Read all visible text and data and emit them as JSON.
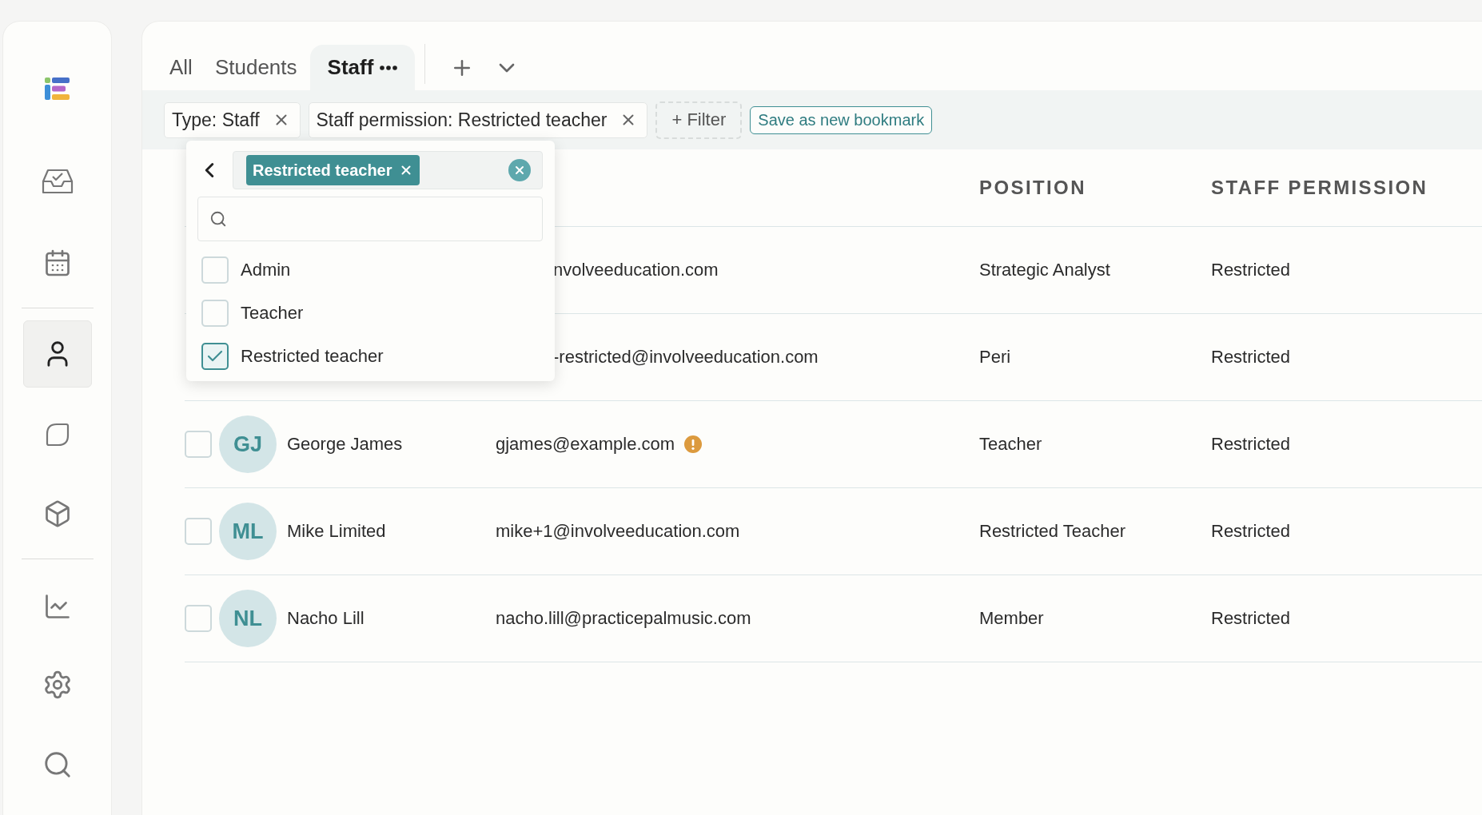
{
  "sidebar": {
    "items": [
      {
        "selected": false
      },
      {
        "selected": false
      },
      {
        "selected": true
      },
      {
        "selected": false
      },
      {
        "selected": false
      },
      {
        "selected": false
      },
      {
        "selected": false
      },
      {
        "selected": false
      }
    ]
  },
  "tabs": [
    {
      "label": "All",
      "selected": false
    },
    {
      "label": "Students",
      "selected": false
    },
    {
      "label": "Staff",
      "selected": true
    }
  ],
  "filters": [
    {
      "label": "Type: Staff"
    },
    {
      "label": "Staff permission: Restricted teacher"
    }
  ],
  "add_filter": "+ Filter",
  "bookmark_button": "Save as new bookmark",
  "dropdown": {
    "selected_tags": [
      "Restricted teacher"
    ],
    "options": [
      {
        "label": "Admin",
        "checked": false
      },
      {
        "label": "Teacher",
        "checked": false
      },
      {
        "label": "Restricted teacher",
        "checked": true
      }
    ]
  },
  "table": {
    "columns": [
      "POSITION",
      "STAFF PERMISSION"
    ],
    "rows": [
      {
        "kind": "covered",
        "email": "nvolveeducation.com",
        "position": "Strategic Analyst",
        "permission": "Restricted"
      },
      {
        "kind": "covered",
        "email": "-restricted@involveeducation.com",
        "position": "Peri",
        "permission": "Restricted"
      },
      {
        "kind": "full",
        "checked": false,
        "initials": "GJ",
        "name": "George James",
        "email": "gjames@example.com",
        "warning": true,
        "position": "Teacher",
        "permission": "Restricted"
      },
      {
        "kind": "full",
        "checked": false,
        "initials": "ML",
        "name": "Mike Limited",
        "email": "mike+1@involveeducation.com",
        "warning": false,
        "position": "Restricted Teacher",
        "permission": "Restricted"
      },
      {
        "kind": "full",
        "checked": false,
        "initials": "NL",
        "name": "Nacho Lill",
        "email": "nacho.lill@practicepalmusic.com",
        "warning": false,
        "position": "Member",
        "permission": "Restricted"
      }
    ]
  }
}
